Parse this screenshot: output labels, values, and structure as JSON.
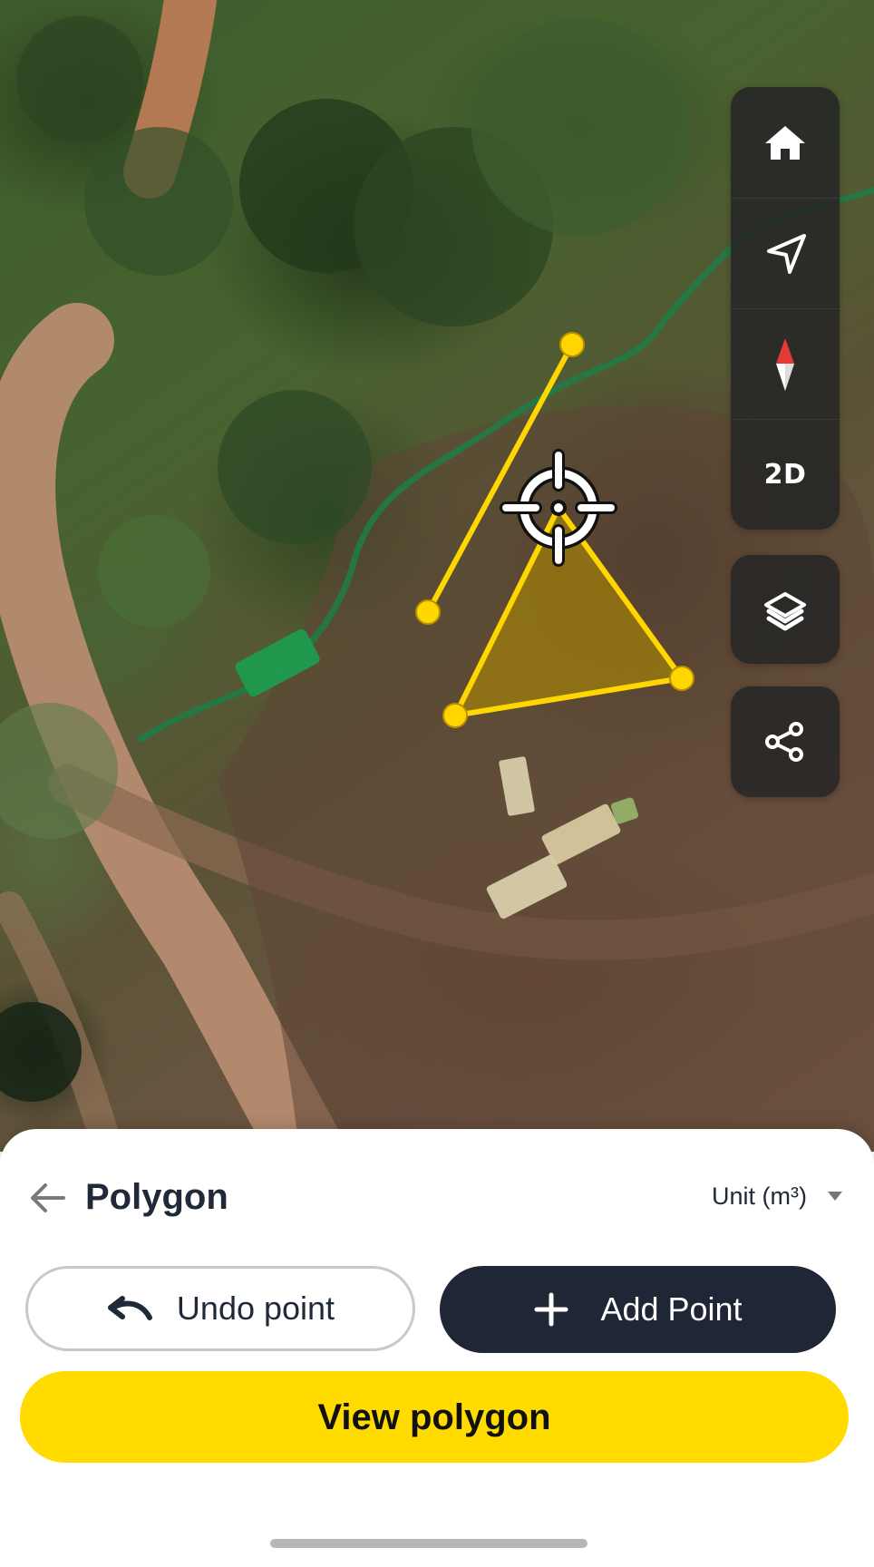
{
  "map": {
    "controls": {
      "home_icon": "home-icon",
      "navigate_icon": "navigation-arrow-icon",
      "compass_icon": "compass-icon",
      "view_mode_label": "2D",
      "layers_icon": "layers-icon",
      "share_icon": "share-icon"
    },
    "polygon_color": "#ffd600",
    "fill_color": "#b28d00"
  },
  "sheet": {
    "title": "Polygon",
    "unit_label": "Unit (m³)",
    "undo_label": "Undo point",
    "add_point_label": "Add Point",
    "view_polygon_label": "View polygon"
  },
  "colors": {
    "accent_yellow": "#ffdb00",
    "dark_button": "#1f2636",
    "outline_border": "#c9c9c9",
    "text_dark": "#1f2937"
  }
}
